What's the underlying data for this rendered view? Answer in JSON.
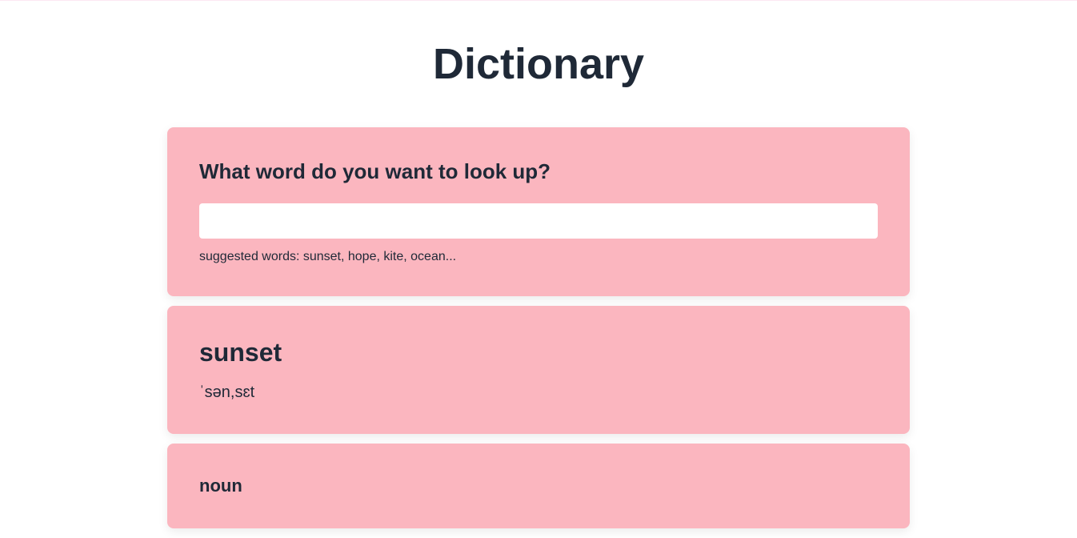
{
  "header": {
    "title": "Dictionary"
  },
  "lookup": {
    "prompt": "What word do you want to look up?",
    "input_value": "",
    "suggested_text": "suggested words: sunset, hope, kite, ocean..."
  },
  "entry": {
    "word": "sunset",
    "phonetic": "ˈsən,sɛt",
    "part_of_speech": "noun"
  }
}
